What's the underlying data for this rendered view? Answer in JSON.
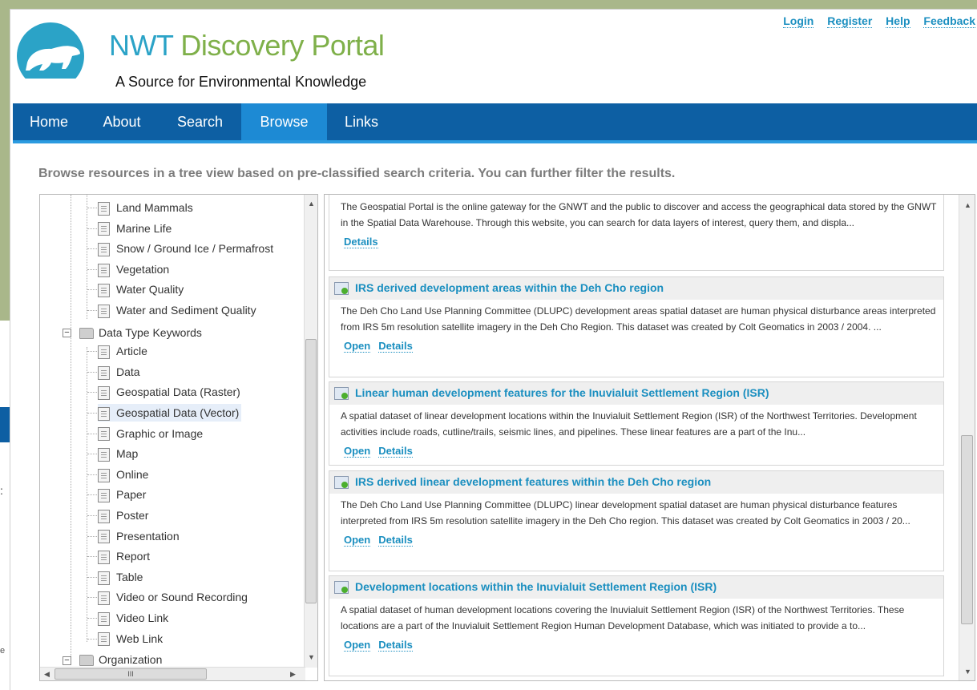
{
  "site": {
    "title_part1": "NWT",
    "title_part2": "Discovery Portal",
    "tagline": "A Source for Environmental Knowledge"
  },
  "top_links": [
    "Login",
    "Register",
    "Help",
    "Feedback"
  ],
  "nav": {
    "items": [
      "Home",
      "About",
      "Search",
      "Browse",
      "Links"
    ],
    "active": "Browse"
  },
  "intro": "Browse resources in a tree view based on pre-classified search criteria. You can further filter the results.",
  "tree": {
    "prev_items": [
      "Land Mammals",
      "Marine Life",
      "Snow / Ground Ice / Permafrost",
      "Vegetation",
      "Water Quality",
      "Water and Sediment Quality"
    ],
    "data_type_folder": "Data Type Keywords",
    "data_type_items": [
      "Article",
      "Data",
      "Geospatial Data (Raster)",
      "Geospatial Data (Vector)",
      "Graphic or Image",
      "Map",
      "Online",
      "Paper",
      "Poster",
      "Presentation",
      "Report",
      "Table",
      "Video or Sound Recording",
      "Video Link",
      "Web Link"
    ],
    "selected": "Geospatial Data (Vector)",
    "next_folder": "Organization",
    "hscroll_label": "III"
  },
  "results": {
    "open_label": "Open",
    "details_label": "Details",
    "partial_desc": "The Geospatial Portal is the online gateway for the GNWT and the public to discover and access the geographical data stored by the GNWT in the Spatial Data Warehouse. Through this website, you can search for data layers of interest, query them, and displa...",
    "items": [
      {
        "title": "IRS derived development areas within the Deh Cho region",
        "desc": "The Deh Cho Land Use Planning Committee (DLUPC) development areas spatial dataset are human physical disturbance areas interpreted from IRS 5m resolution satellite imagery in the Deh Cho Region. This dataset was created by Colt Geomatics in 2003 / 2004. ..."
      },
      {
        "title": "Linear human development features for the Inuvialuit Settlement Region (ISR)",
        "desc": "A spatial dataset of linear development locations within the Inuvialuit Settlement Region (ISR) of the Northwest Territories. Development activities include roads, cutline/trails, seismic lines, and pipelines. These linear features are a part of the Inu..."
      },
      {
        "title": "IRS derived linear development features within the Deh Cho region",
        "desc": "The Deh Cho Land Use Planning Committee (DLUPC) linear development spatial dataset are human physical disturbance features interpreted from IRS 5m resolution satellite imagery in the Deh Cho region. This dataset was created by Colt Geomatics in 2003 / 20..."
      },
      {
        "title": "Development locations within the Inuvialuit Settlement Region (ISR)",
        "desc": "A spatial dataset of human development locations covering the Inuvialuit Settlement Region (ISR) of the Northwest Territories. These locations are a part of the Inuvialuit Settlement Region Human Development Database, which was initiated to provide a to..."
      }
    ]
  },
  "background_fragments": {
    "colon": ":",
    "e_text": "e"
  },
  "colors": {
    "nav": "#0d5fa3",
    "nav_active": "#1d8ad4",
    "link": "#1b8fc0",
    "title_blue": "#2ba3c7",
    "title_green": "#7fb04a"
  }
}
